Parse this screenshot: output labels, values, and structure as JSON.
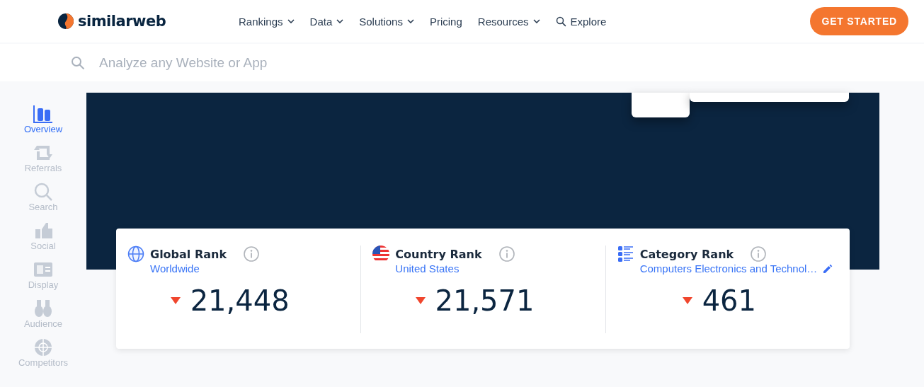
{
  "header": {
    "logo": "similarweb",
    "nav": [
      {
        "label": "Rankings",
        "dropdown": true
      },
      {
        "label": "Data",
        "dropdown": true
      },
      {
        "label": "Solutions",
        "dropdown": true
      },
      {
        "label": "Pricing",
        "dropdown": false
      },
      {
        "label": "Resources",
        "dropdown": true
      }
    ],
    "explore": "Explore",
    "cta": "GET STARTED"
  },
  "search": {
    "placeholder": "Analyze any Website or App"
  },
  "sidebar": {
    "items": [
      {
        "label": "Overview",
        "kind": "overview",
        "selected": true
      },
      {
        "label": "Referrals",
        "kind": "referrals",
        "selected": false
      },
      {
        "label": "Search",
        "kind": "search",
        "selected": false
      },
      {
        "label": "Social",
        "kind": "social",
        "selected": false
      },
      {
        "label": "Display",
        "kind": "display",
        "selected": false
      },
      {
        "label": "Audience",
        "kind": "audience",
        "selected": false
      },
      {
        "label": "Competitors",
        "kind": "competitors",
        "selected": false
      }
    ]
  },
  "ranks": [
    {
      "kind": "global",
      "title": "Global Rank",
      "subtitle": "Worldwide",
      "value": "21,448",
      "editable": false
    },
    {
      "kind": "country",
      "title": "Country Rank",
      "subtitle": "United States",
      "value": "21,571",
      "editable": false
    },
    {
      "kind": "category",
      "title": "Category Rank",
      "subtitle": "Computers Electronics and Technol…",
      "value": "461",
      "editable": true
    }
  ]
}
